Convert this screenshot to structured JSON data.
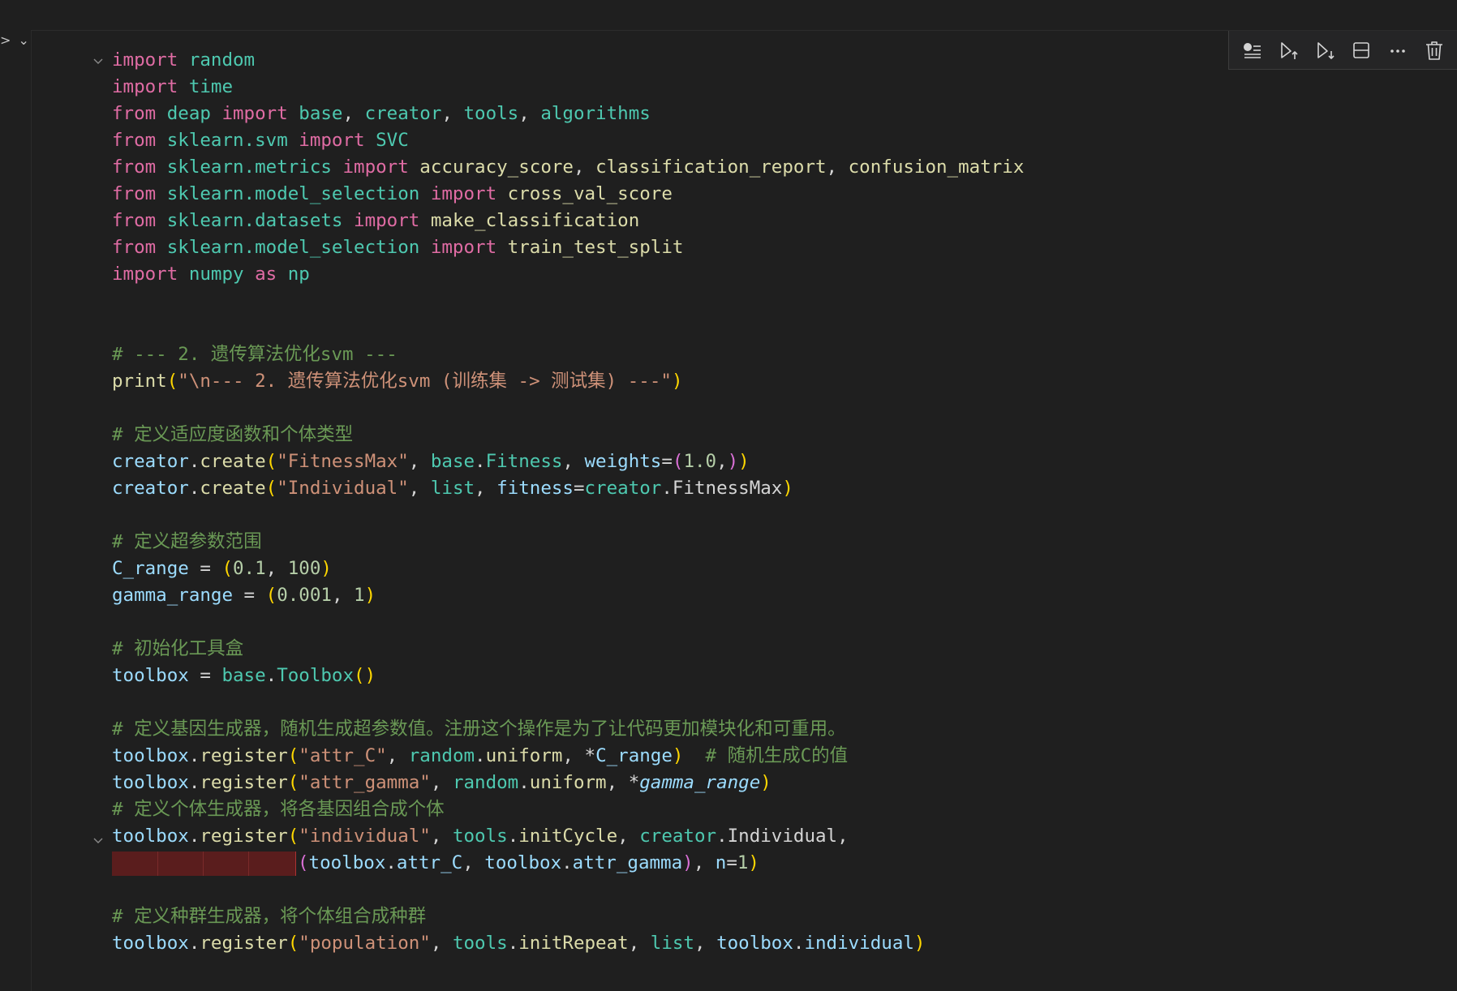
{
  "toolbar": {
    "buttons": [
      {
        "name": "variables-icon",
        "label": "Variables"
      },
      {
        "name": "run-above-icon",
        "label": "Run above"
      },
      {
        "name": "run-below-icon",
        "label": "Run below"
      },
      {
        "name": "split-cell-icon",
        "label": "Split cell"
      },
      {
        "name": "more-actions-icon",
        "label": "More actions"
      },
      {
        "name": "delete-cell-icon",
        "label": "Delete cell"
      }
    ],
    "more_label": "···"
  },
  "gutter": {
    "chevrons": "> ⌄"
  },
  "code": {
    "l1": {
      "t1": "import",
      "t2": " random"
    },
    "l2": {
      "t1": "import",
      "t2": " time"
    },
    "l3": {
      "t1": "from",
      "t2": " deap ",
      "t3": "import",
      "t4": " base",
      "t5": ", ",
      "t6": "creator",
      "t7": ", ",
      "t8": "tools",
      "t9": ", ",
      "t10": "algorithms"
    },
    "l4": {
      "t1": "from",
      "t2": " sklearn.svm ",
      "t3": "import",
      "t4": " SVC"
    },
    "l5": {
      "t1": "from",
      "t2": " sklearn.metrics ",
      "t3": "import",
      "t4": " accuracy_score",
      "t5": ", ",
      "t6": "classification_report",
      "t7": ", ",
      "t8": "confusion_matrix"
    },
    "l6": {
      "t1": "from",
      "t2": " sklearn.model_selection ",
      "t3": "import",
      "t4": " cross_val_score"
    },
    "l7": {
      "t1": "from",
      "t2": " sklearn.datasets ",
      "t3": "import",
      "t4": " make_classification"
    },
    "l8": {
      "t1": "from",
      "t2": " sklearn.model_selection ",
      "t3": "import",
      "t4": " train_test_split"
    },
    "l9": {
      "t1": "import",
      "t2": " numpy ",
      "t3": "as",
      "t4": " np"
    },
    "l10": {
      "t1": "# --- 2. 遗传算法优化svm ---"
    },
    "l11": {
      "t1": "print",
      "t2": "(",
      "t3": "\"\\n--- 2. 遗传算法优化svm (训练集 -> 测试集) ---\"",
      "t4": ")"
    },
    "l12": {
      "t1": "# 定义适应度函数和个体类型"
    },
    "l13": {
      "t1": "creator",
      "t2": ".",
      "t3": "create",
      "t4": "(",
      "t5": "\"FitnessMax\"",
      "t6": ", ",
      "t7": "base",
      "t8": ".",
      "t9": "Fitness",
      "t10": ", ",
      "t11": "weights",
      "t12": "=",
      "t13": "(",
      "t14": "1.0",
      "t15": ",",
      "t16": ")",
      "t17": ")"
    },
    "l14": {
      "t1": "creator",
      "t2": ".",
      "t3": "create",
      "t4": "(",
      "t5": "\"Individual\"",
      "t6": ", ",
      "t7": "list",
      "t8": ", ",
      "t9": "fitness",
      "t10": "=",
      "t11": "creator",
      "t12": ".",
      "t13": "FitnessMax",
      "t14": ")"
    },
    "l15": {
      "t1": "# 定义超参数范围"
    },
    "l16": {
      "t1": "C_range",
      "t2": " = ",
      "t3": "(",
      "t4": "0.1",
      "t5": ", ",
      "t6": "100",
      "t7": ")"
    },
    "l17": {
      "t1": "gamma_range",
      "t2": " = ",
      "t3": "(",
      "t4": "0.001",
      "t5": ", ",
      "t6": "1",
      "t7": ")"
    },
    "l18": {
      "t1": "# 初始化工具盒"
    },
    "l19": {
      "t1": "toolbox",
      "t2": " = ",
      "t3": "base",
      "t4": ".",
      "t5": "Toolbox",
      "t6": "()"
    },
    "l20": {
      "t1": "# 定义基因生成器，随机生成超参数值。注册这个操作是为了让代码更加模块化和可重用。"
    },
    "l21": {
      "t1": "toolbox",
      "t2": ".",
      "t3": "register",
      "t4": "(",
      "t5": "\"attr_C\"",
      "t6": ", ",
      "t7": "random",
      "t8": ".",
      "t9": "uniform",
      "t10": ", *",
      "t11": "C_range",
      "t12": ")",
      "t13": "  # 随机生成C的值"
    },
    "l22": {
      "t1": "toolbox",
      "t2": ".",
      "t3": "register",
      "t4": "(",
      "t5": "\"attr_gamma\"",
      "t6": ", ",
      "t7": "random",
      "t8": ".",
      "t9": "uniform",
      "t10": ", *",
      "t11": "gamma_range",
      "t12": ")"
    },
    "l23": {
      "t1": "# 定义个体生成器，将各基因组合成个体"
    },
    "l24": {
      "t1": "toolbox",
      "t2": ".",
      "t3": "register",
      "t4": "(",
      "t5": "\"individual\"",
      "t6": ", ",
      "t7": "tools",
      "t8": ".",
      "t9": "initCycle",
      "t10": ", ",
      "t11": "creator",
      "t12": ".",
      "t13": "Individual",
      "t14": ","
    },
    "l25": {
      "t1": "(",
      "t2": "toolbox",
      "t3": ".",
      "t4": "attr_C",
      "t5": ", ",
      "t6": "toolbox",
      "t7": ".",
      "t8": "attr_gamma",
      "t9": ")",
      "t10": ", ",
      "t11": "n",
      "t12": "=",
      "t13": "1",
      "t14": ")"
    },
    "l26": {
      "t1": "# 定义种群生成器，将个体组合成种群"
    },
    "l27": {
      "t1": "toolbox",
      "t2": ".",
      "t3": "register",
      "t4": "(",
      "t5": "\"population\"",
      "t6": ", ",
      "t7": "tools",
      "t8": ".",
      "t9": "initRepeat",
      "t10": ", ",
      "t11": "list",
      "t12": ", ",
      "t13": "toolbox",
      "t14": ".",
      "t15": "individual",
      "t16": ")"
    }
  },
  "colors": {
    "keyword": "#e06ca4",
    "module": "#4ec9b0",
    "function": "#dcdcaa",
    "variable": "#9cdcfe",
    "string": "#ce9178",
    "number": "#b5cea8",
    "comment": "#6a9955",
    "error_highlight": "#5a1d1d"
  }
}
